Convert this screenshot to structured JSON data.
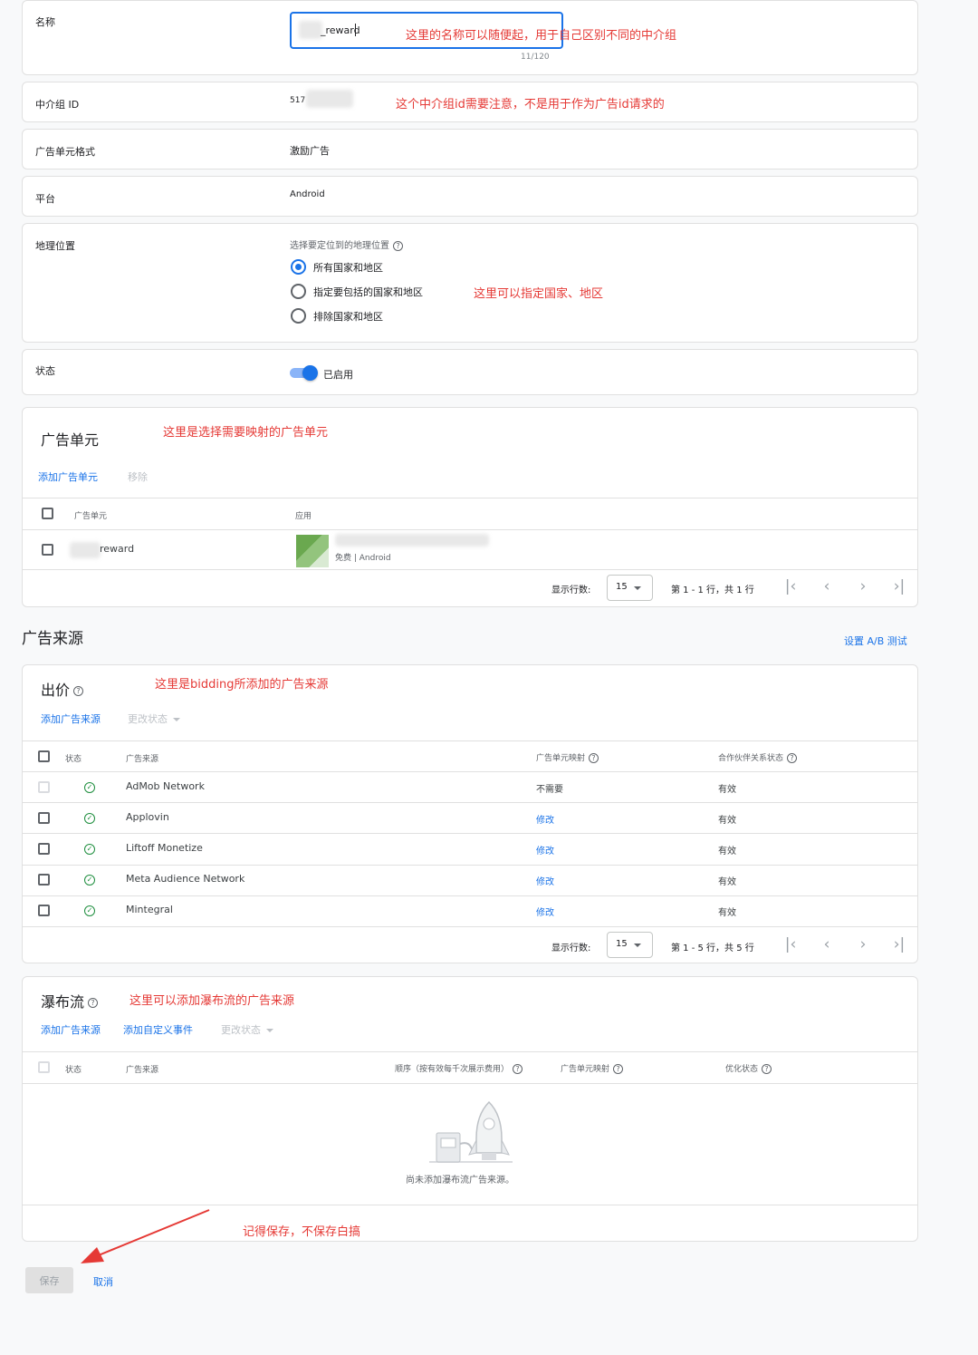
{
  "name_row": {
    "label": "名称",
    "input_value": "_reward",
    "counter": "11/120",
    "annotation": "这里的名称可以随便起，用于自己区别不同的中介组"
  },
  "group_id_row": {
    "label": "中介组 ID",
    "value": "517",
    "annotation": "这个中介组id需要注意，不是用于作为广告id请求的"
  },
  "format_row": {
    "label": "广告单元格式",
    "value": "激励广告"
  },
  "platform_row": {
    "label": "平台",
    "value": "Android"
  },
  "geo_row": {
    "label": "地理位置",
    "prompt": "选择要定位到的地理位置",
    "options": [
      "所有国家和地区",
      "指定要包括的国家和地区",
      "排除国家和地区"
    ],
    "selected": 0,
    "annotation": "这里可以指定国家、地区"
  },
  "status_row": {
    "label": "状态",
    "toggle_label": "已启用"
  },
  "ad_units": {
    "title": "广告单元",
    "annotation": "这里是选择需要映射的广告单元",
    "add_link": "添加广告单元",
    "remove_link": "移除",
    "columns": [
      "广告单元",
      "应用"
    ],
    "rows": [
      {
        "unit": "reward",
        "app_meta": "免费 | Android"
      }
    ],
    "pager": {
      "rows_label": "显示行数:",
      "page_size": "15",
      "range": "第 1 - 1 行，共 1 行"
    }
  },
  "ad_sources": {
    "title": "广告来源",
    "ab_test_link": "设置 A/B 测试"
  },
  "bidding": {
    "title": "出价",
    "annotation": "这里是bidding所添加的广告来源",
    "add_link": "添加广告来源",
    "change_status": "更改状态",
    "columns": [
      "状态",
      "广告来源",
      "广告单元映射",
      "合作伙伴关系状态"
    ],
    "rows": [
      {
        "source": "AdMob Network",
        "mapping": "不需要",
        "partner": "有效"
      },
      {
        "source": "Applovin",
        "mapping": "修改",
        "partner": "有效"
      },
      {
        "source": "Liftoff Monetize",
        "mapping": "修改",
        "partner": "有效"
      },
      {
        "source": "Meta Audience Network",
        "mapping": "修改",
        "partner": "有效"
      },
      {
        "source": "Mintegral",
        "mapping": "修改",
        "partner": "有效"
      }
    ],
    "pager": {
      "rows_label": "显示行数:",
      "page_size": "15",
      "range": "第 1 - 5 行，共 5 行"
    }
  },
  "waterfall": {
    "title": "瀑布流",
    "annotation": "这里可以添加瀑布流的广告来源",
    "add_link": "添加广告来源",
    "custom_event_link": "添加自定义事件",
    "change_status": "更改状态",
    "columns": [
      "状态",
      "广告来源",
      "顺序（按有效每千次展示费用）",
      "广告单元映射",
      "优化状态"
    ],
    "empty_text": "尚未添加瀑布流广告来源。"
  },
  "footer": {
    "annotation": "记得保存，不保存白搞",
    "save_label": "保存",
    "cancel_label": "取消"
  },
  "colors": {
    "primary": "#1a73e8",
    "annotation": "#e53935",
    "success": "#1e8e3e"
  },
  "icons": [
    "help-icon",
    "check-circle-icon",
    "chevron-down-icon",
    "first-page-icon",
    "prev-page-icon",
    "next-page-icon",
    "last-page-icon",
    "rocket-illustration-icon",
    "arrow-annotation-icon"
  ]
}
